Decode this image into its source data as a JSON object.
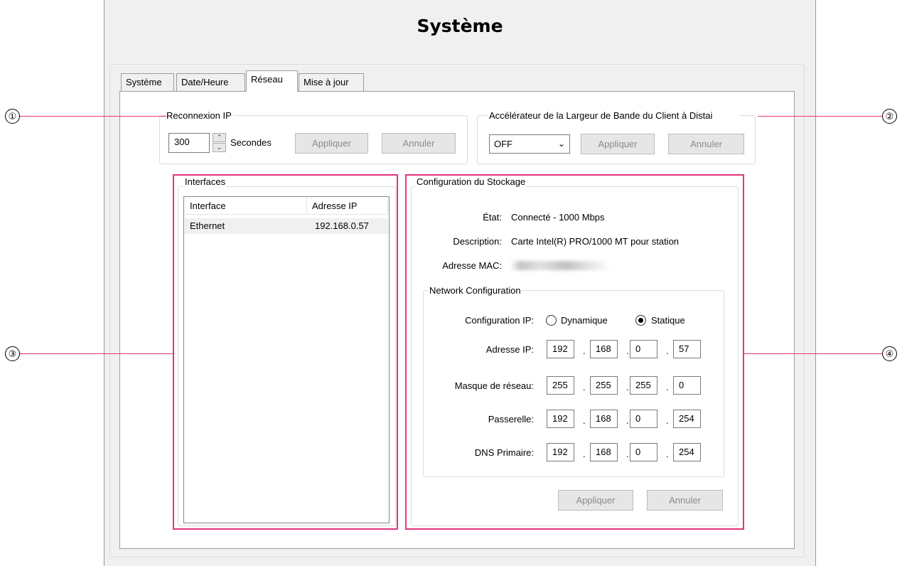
{
  "window": {
    "title": "Système"
  },
  "tabs": [
    {
      "label": "Système",
      "active": false
    },
    {
      "label": "Date/Heure",
      "active": false
    },
    {
      "label": "Réseau",
      "active": true
    },
    {
      "label": "Mise à jour",
      "active": false
    }
  ],
  "reconnect": {
    "group_label": "Reconnexion IP",
    "value": "300",
    "unit": "Secondes",
    "apply_label": "Appliquer",
    "cancel_label": "Annuler"
  },
  "accelerator": {
    "group_label": "Accélérateur de la Largeur de Bande du Client à Distai",
    "selected": "OFF",
    "apply_label": "Appliquer",
    "cancel_label": "Annuler"
  },
  "interfaces": {
    "group_label": "Interfaces",
    "columns": [
      "Interface",
      "Adresse IP"
    ],
    "rows": [
      {
        "interface": "Ethernet",
        "ip": "192.168.0.57"
      }
    ]
  },
  "storage": {
    "group_label": "Configuration du Stockage",
    "state_label": "État:",
    "state_value": "Connecté - 1000 Mbps",
    "description_label": "Description:",
    "description_value": "Carte Intel(R) PRO/1000 MT pour station",
    "mac_label": "Adresse MAC:",
    "network": {
      "group_label": "Network Configuration",
      "ip_config_label": "Configuration IP:",
      "option_dynamic": "Dynamique",
      "option_static": "Statique",
      "selected": "Statique",
      "ip_label": "Adresse IP:",
      "ip": [
        "192",
        "168",
        "0",
        "57"
      ],
      "mask_label": "Masque de réseau:",
      "mask": [
        "255",
        "255",
        "255",
        "0"
      ],
      "gateway_label": "Passerelle:",
      "gateway": [
        "192",
        "168",
        "0",
        "254"
      ],
      "dns_label": "DNS Primaire:",
      "dns": [
        "192",
        "168",
        "0",
        "254"
      ]
    },
    "apply_label": "Appliquer",
    "cancel_label": "Annuler"
  },
  "callouts": [
    "①",
    "②",
    "③",
    "④"
  ],
  "colors": {
    "highlight": "#e4347e",
    "panel": "#f0f0f0"
  }
}
